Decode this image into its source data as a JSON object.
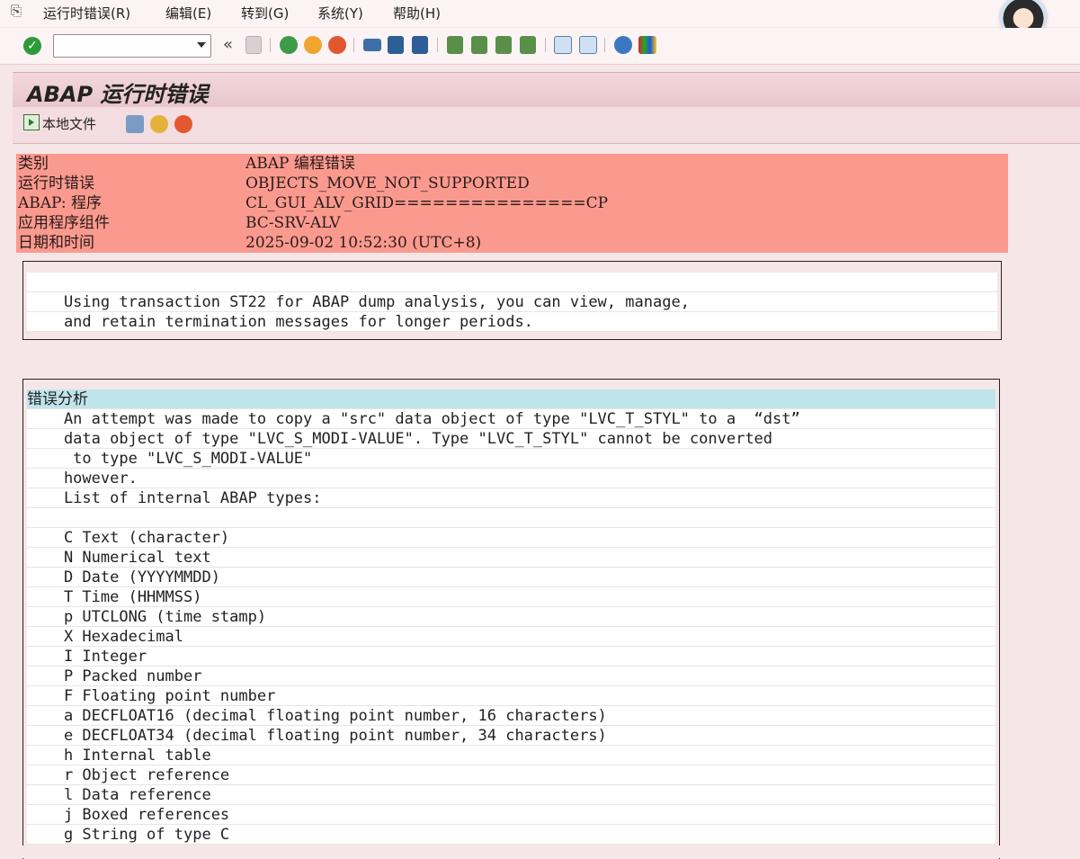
{
  "menu": {
    "items": [
      {
        "label": "运行时错误(R)"
      },
      {
        "label": "编辑(E)"
      },
      {
        "label": "转到(G)"
      },
      {
        "label": "系统(Y)"
      },
      {
        "label": "帮助(H)"
      }
    ]
  },
  "toolbar": {
    "enter_symbol": "✓",
    "collapse_symbol": "«",
    "command_field_value": ""
  },
  "title": "ABAP 运行时错误",
  "app_toolbar": {
    "local_file_label": "本地文件"
  },
  "header": {
    "rows": [
      {
        "label": "类别",
        "value": "ABAP 编程错误"
      },
      {
        "label": "运行时错误",
        "value": "OBJECTS_MOVE_NOT_SUPPORTED"
      },
      {
        "label": "ABAP: 程序",
        "value": "CL_GUI_ALV_GRID===============CP"
      },
      {
        "label": "应用程序组件",
        "value": "BC-SRV-ALV"
      },
      {
        "label": "日期和时间",
        "value": "2025-09-02 10:52:30 (UTC+8)"
      }
    ]
  },
  "hint": {
    "lines": [
      "",
      "    Using transaction ST22 for ABAP dump analysis, you can view, manage,",
      "    and retain termination messages for longer periods."
    ]
  },
  "analysis": {
    "heading": "错误分析",
    "lines": [
      "    An attempt was made to copy a \"src\" data object of type \"LVC_T_STYL\" to a  “dst”",
      "    data object of type \"LVC_S_MODI-VALUE\". Type \"LVC_T_STYL\" cannot be converted",
      "     to type \"LVC_S_MODI-VALUE\"",
      "    however.",
      "    List of internal ABAP types:",
      "",
      "    C Text (character)",
      "    N Numerical text",
      "    D Date (YYYYMMDD)",
      "    T Time (HHMMSS)",
      "    p UTCLONG (time stamp)",
      "    X Hexadecimal",
      "    I Integer",
      "    P Packed number",
      "    F Floating point number",
      "    a DECFLOAT16 (decimal floating point number, 16 characters)",
      "    e DECFLOAT34 (decimal floating point number, 34 characters)",
      "    h Internal table",
      "    r Object reference",
      "    l Data reference",
      "    j Boxed references",
      "    g String of type C"
    ]
  },
  "colors": {
    "header_row_bg": "#fa9a8e",
    "highlight_bg": "#bfe5ea",
    "page_bg": "#f6e6e8"
  }
}
